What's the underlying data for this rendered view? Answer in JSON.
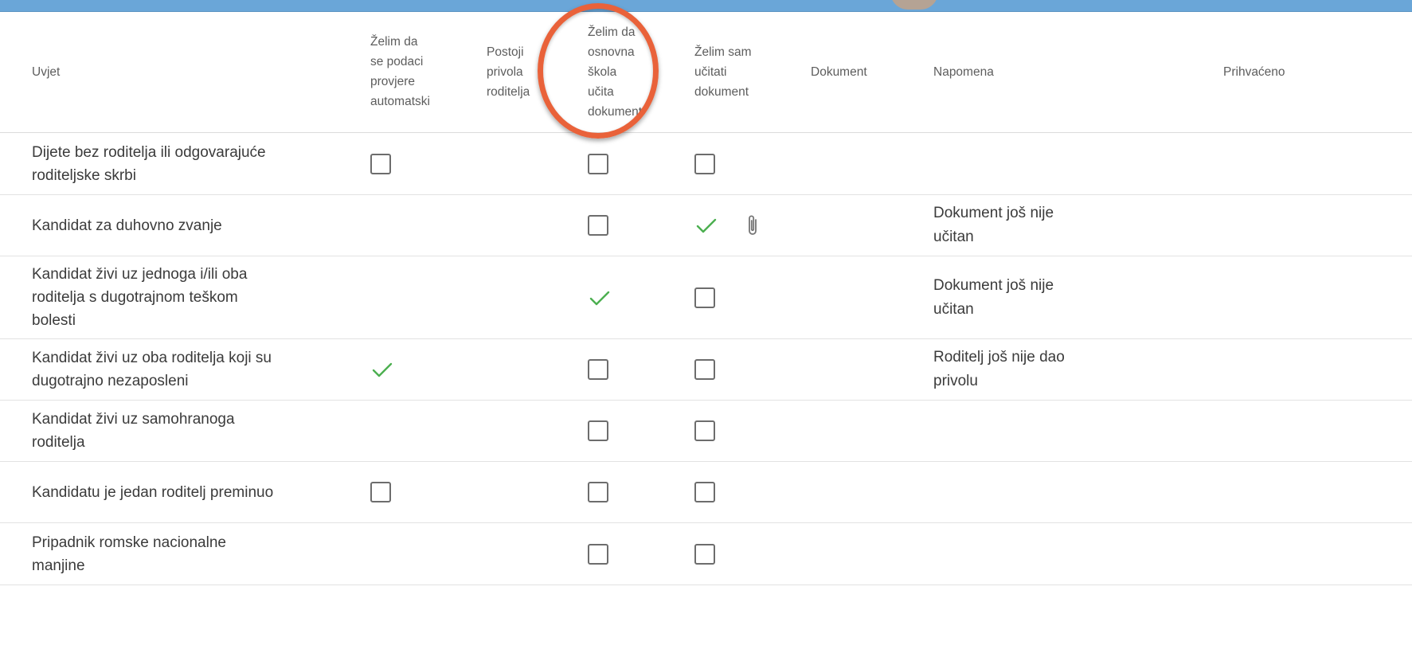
{
  "colors": {
    "accent_bar": "#6aa6d8",
    "check_green": "#4caf50",
    "highlight_ring": "#e9623a"
  },
  "table": {
    "headers": {
      "uvjet": "Uvjet",
      "auto": [
        "Želim da",
        "se podaci",
        "provjere",
        "automatski"
      ],
      "privola": [
        "Postoji",
        "privola",
        "roditelja"
      ],
      "skola": [
        "Želim da",
        "osnovna",
        "škola",
        "učita",
        "dokument"
      ],
      "sam": [
        "Želim sam",
        "učitati",
        "dokument"
      ],
      "dokument": "Dokument",
      "napomena": "Napomena",
      "prihvaceno": "Prihvaćeno"
    },
    "rows": [
      {
        "uvjet": [
          "Dijete bez roditelja ili odgovarajuće",
          "roditeljske skrbi"
        ],
        "auto": "checkbox",
        "skola": "checkbox",
        "sam": "checkbox",
        "dokument_icon": "",
        "napomena": [
          "",
          ""
        ]
      },
      {
        "uvjet": [
          "Kandidat za duhovno zvanje"
        ],
        "auto": "",
        "skola": "checkbox",
        "sam": "check",
        "dokument_icon": "paperclip-icon",
        "napomena": [
          "Dokument još nije",
          "učitan"
        ]
      },
      {
        "uvjet": [
          "Kandidat živi uz jednoga i/ili oba",
          "roditelja s dugotrajnom teškom",
          "bolesti"
        ],
        "auto": "",
        "skola": "check",
        "sam": "checkbox",
        "dokument_icon": "",
        "napomena": [
          "Dokument još nije",
          "učitan"
        ]
      },
      {
        "uvjet": [
          "Kandidat živi uz oba roditelja koji su",
          "dugotrajno nezaposleni"
        ],
        "auto": "check",
        "skola": "checkbox",
        "sam": "checkbox",
        "dokument_icon": "",
        "napomena": [
          "Roditelj još nije dao",
          "privolu"
        ]
      },
      {
        "uvjet": [
          "Kandidat živi uz samohranoga",
          "roditelja"
        ],
        "auto": "",
        "skola": "checkbox",
        "sam": "checkbox",
        "dokument_icon": "",
        "napomena": [
          "",
          ""
        ]
      },
      {
        "uvjet": [
          "Kandidatu je jedan roditelj preminuo"
        ],
        "auto": "checkbox",
        "skola": "checkbox",
        "sam": "checkbox",
        "dokument_icon": "",
        "napomena": [
          "",
          ""
        ]
      },
      {
        "uvjet": [
          "Pripadnik romske nacionalne",
          "manjine"
        ],
        "auto": "",
        "skola": "checkbox",
        "sam": "checkbox",
        "dokument_icon": "",
        "napomena": [
          "",
          ""
        ]
      }
    ]
  }
}
